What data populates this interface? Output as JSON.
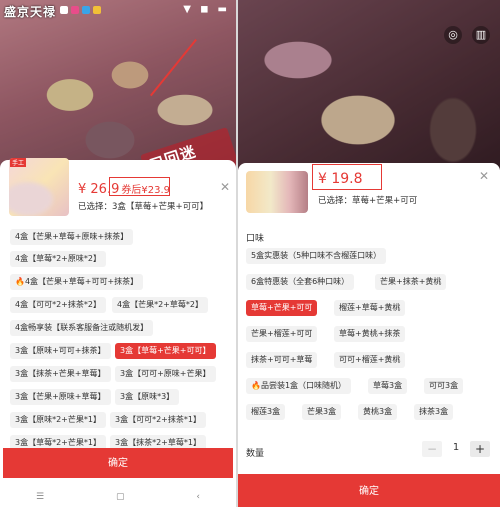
{
  "left": {
    "shop_name": "盛京天禄",
    "status_dot_colors": [
      "#ffffff",
      "#e84d8a",
      "#3aa4e8",
      "#f2c037"
    ],
    "status_icons": "▼ ◼ ▬",
    "photo_stamp": "口回迷店！",
    "thumb_label": "手工",
    "price_prefix": "¥ 26.9",
    "price_after": "券后¥23.9",
    "selected_text": "已选择：3盒【草莓+芒果+可可】",
    "options": [
      "4盒【芒果+草莓+原味+抹茶】",
      "4盒【草莓*2+原味*2】",
      "4盒【芒果+草莓+可可+抹茶】",
      "4盒【可可*2+抹茶*2】",
      "4盒【芒果*2+草莓*2】",
      "4盒畅享装【联系客服备注或随机发】",
      "3盒【原味+可可+抹茶】",
      "3盒【草莓+芒果+可可】",
      "3盒【抹茶+芒果+草莓】",
      "3盒【可可+原味+芒果】",
      "3盒【芒果+原味+草莓】",
      "3盒【原味*3】",
      "3盒【原味*2+芒果*1】",
      "3盒【可可*2+抹茶*1】",
      "3盒【草莓*2+芒果*1】",
      "3盒【抹茶*2+草莓*1】"
    ],
    "fire_marker": "🔥",
    "confirm": "确定",
    "nav": [
      "☰",
      "▢",
      "‹"
    ],
    "close": "✕"
  },
  "right": {
    "price": "¥ 19.8",
    "selected_text": "已选择：草莓+芒果+可可",
    "section_flavor": "口味",
    "options": [
      "5盒实惠装（5种口味不含榴莲口味）",
      "6盒特惠装（全套6种口味）",
      "芒果+抹茶+黄桃",
      "草莓+芒果+可可",
      "榴莲+草莓+黄桃",
      "芒果+榴莲+可可",
      "草莓+黄桃+抹茶",
      "抹茶+可可+草莓",
      "可可+榴莲+黄桃",
      "品尝装1盒（口味随机）",
      "草莓3盒",
      "可可3盒",
      "榴莲3盒",
      "芒果3盒",
      "黄桃3盒",
      "抹茶3盒"
    ],
    "fire_marker": "🔥",
    "qty_label": "数量",
    "qty_minus": "−",
    "qty_value": "1",
    "qty_plus": "+",
    "confirm": "确定",
    "close": "✕",
    "photo_icons": [
      "◎",
      "▥"
    ]
  },
  "colors": {
    "accent": "#e53935",
    "chip_bg": "#f2f2f2"
  }
}
